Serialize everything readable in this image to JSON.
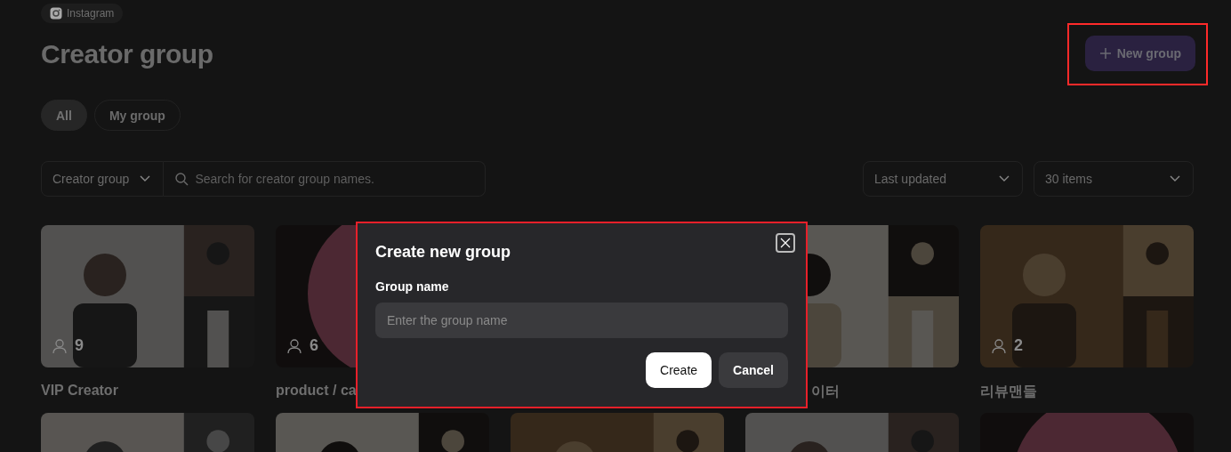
{
  "platform_chip": {
    "label": "Instagram"
  },
  "title": "Creator group",
  "new_group_button": {
    "label": "New group",
    "highlighted": true
  },
  "tabs": [
    {
      "label": "All",
      "selected": true
    },
    {
      "label": "My group",
      "selected": false
    }
  ],
  "filter": {
    "scope": "Creator group",
    "placeholder": "Search for creator group names."
  },
  "sort_select": "Last updated",
  "page_size_select": "30 items",
  "cards": [
    {
      "kind": "card",
      "count": "9",
      "title": "VIP Creator"
    },
    {
      "kind": "card",
      "count": "6",
      "title": "product / ca"
    },
    {
      "kind": "covered"
    },
    {
      "kind": "card",
      "title": "이터",
      "title_cut_before": true
    },
    {
      "kind": "card",
      "count": "2",
      "title": "리뷰맨들"
    }
  ],
  "modal": {
    "title": "Create new group",
    "highlighted": true,
    "field_label": "Group name",
    "placeholder": "Enter the group name",
    "buttons": [
      {
        "label": "Create",
        "kind": "primary"
      },
      {
        "label": "Cancel",
        "kind": "secondary"
      }
    ]
  }
}
